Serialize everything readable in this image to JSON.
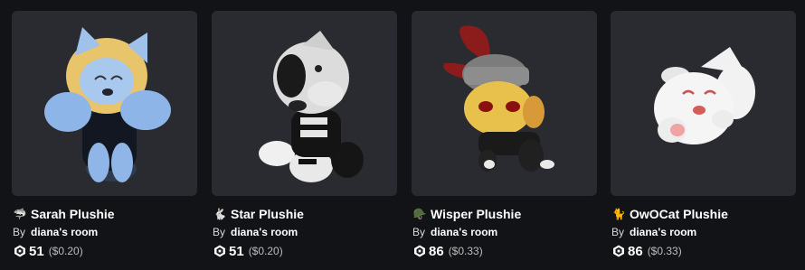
{
  "items": [
    {
      "emoji": "🦈",
      "name": "Sarah Plushie",
      "by": "By",
      "creator": "diana's room",
      "robux": "51",
      "usd": "($0.20)",
      "icon": "shark-icon"
    },
    {
      "emoji": "🐇",
      "name": "Star Plushie",
      "by": "By",
      "creator": "diana's room",
      "robux": "51",
      "usd": "($0.20)",
      "icon": "rabbit-icon"
    },
    {
      "emoji": "🪖",
      "name": "Wisper Plushie",
      "by": "By",
      "creator": "diana's room",
      "robux": "86",
      "usd": "($0.33)",
      "icon": "helmet-icon"
    },
    {
      "emoji": "🐈",
      "name": "OwOCat Plushie",
      "by": "By",
      "creator": "diana's room",
      "robux": "86",
      "usd": "($0.33)",
      "icon": "cat-icon"
    }
  ],
  "colors": {
    "background": "#121316",
    "card": "#2a2b30",
    "muted": "#bdbdbd"
  }
}
